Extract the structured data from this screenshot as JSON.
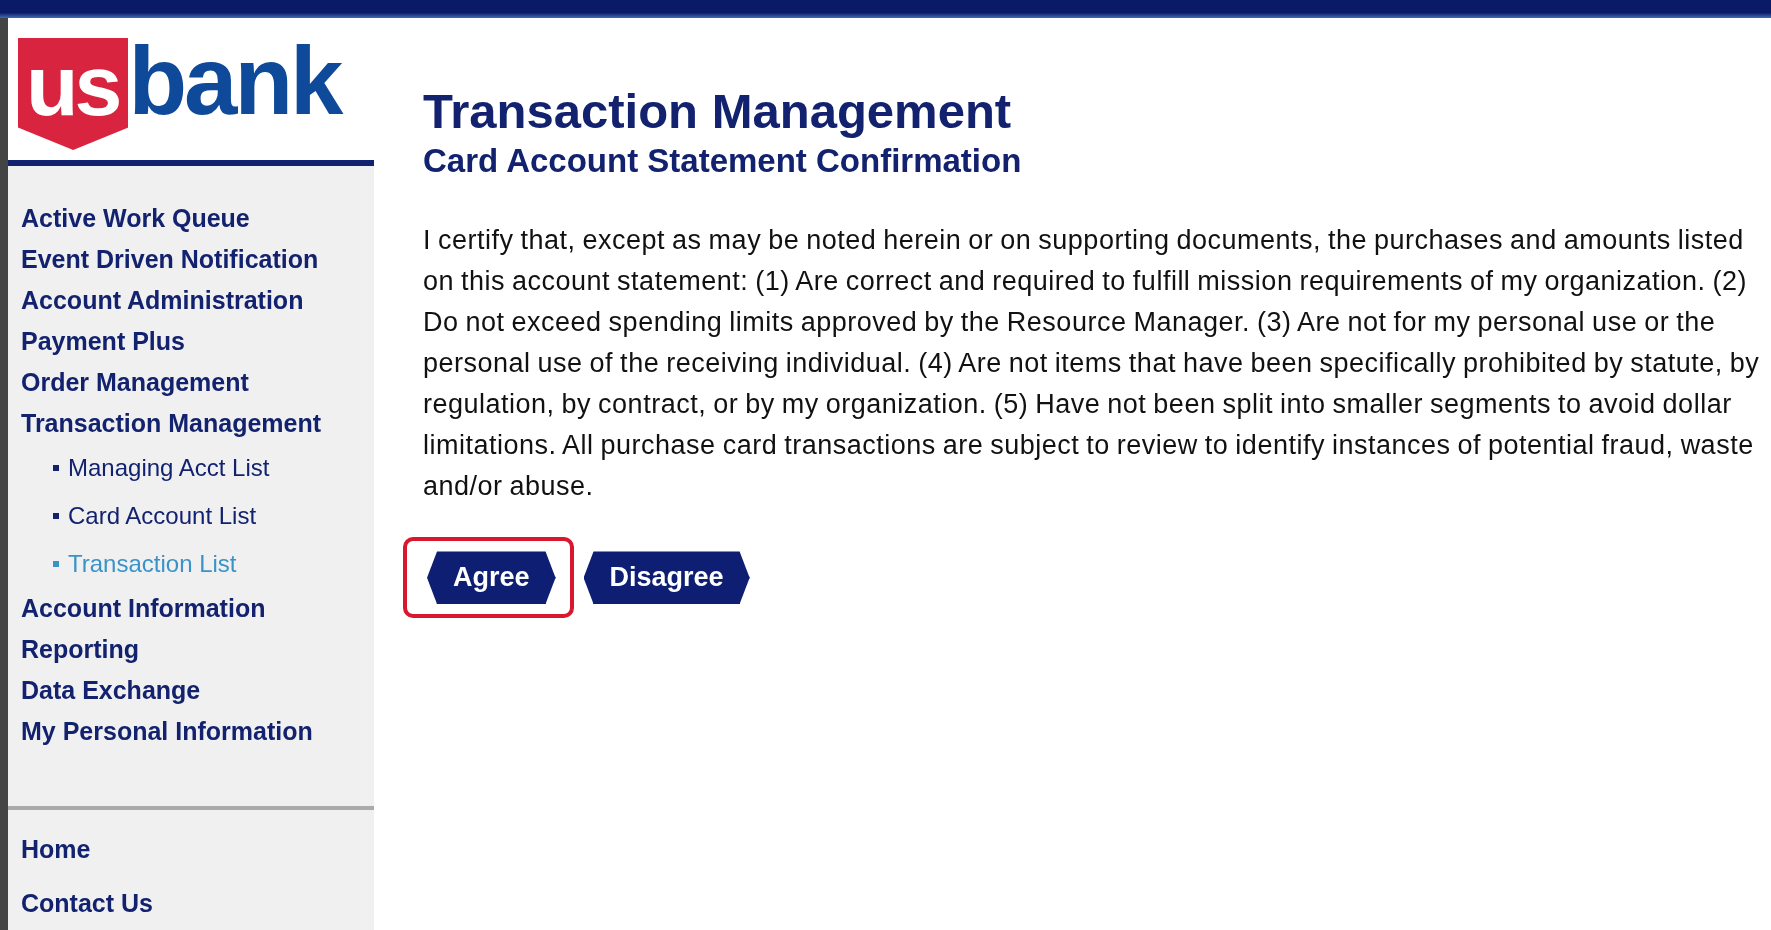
{
  "logo": {
    "mark": "us",
    "word": "bank"
  },
  "sidebar": {
    "items": [
      {
        "label": "Active Work Queue"
      },
      {
        "label": "Event Driven Notification"
      },
      {
        "label": "Account Administration"
      },
      {
        "label": "Payment Plus"
      },
      {
        "label": "Order Management"
      },
      {
        "label": "Transaction Management",
        "children": [
          {
            "label": "Managing Acct List",
            "selected": false
          },
          {
            "label": "Card Account List",
            "selected": false
          },
          {
            "label": "Transaction List",
            "selected": true
          }
        ]
      },
      {
        "label": "Account Information"
      },
      {
        "label": "Reporting"
      },
      {
        "label": "Data Exchange"
      },
      {
        "label": "My Personal Information"
      }
    ],
    "footer_items": [
      {
        "label": "Home"
      },
      {
        "label": "Contact Us"
      }
    ]
  },
  "page": {
    "title": "Transaction Management",
    "subtitle": "Card Account Statement Confirmation",
    "body": "I certify that, except as may be noted herein or on supporting documents, the purchases and amounts listed on this account statement: (1) Are correct and required to fulfill mission requirements of my organization. (2) Do not exceed spending limits approved by the Resource Manager. (3) Are not for my personal use or the personal use of the receiving individual. (4) Are not items that have been specifically prohibited by statute, by regulation, by contract, or by my organization. (5) Have not been split into smaller segments to avoid dollar limitations. All purchase card transactions are subject to review to identify instances of potential fraud, waste and/or abuse.",
    "buttons": [
      {
        "label": "Agree",
        "highlighted": true
      },
      {
        "label": "Disagree",
        "highlighted": false
      }
    ]
  }
}
